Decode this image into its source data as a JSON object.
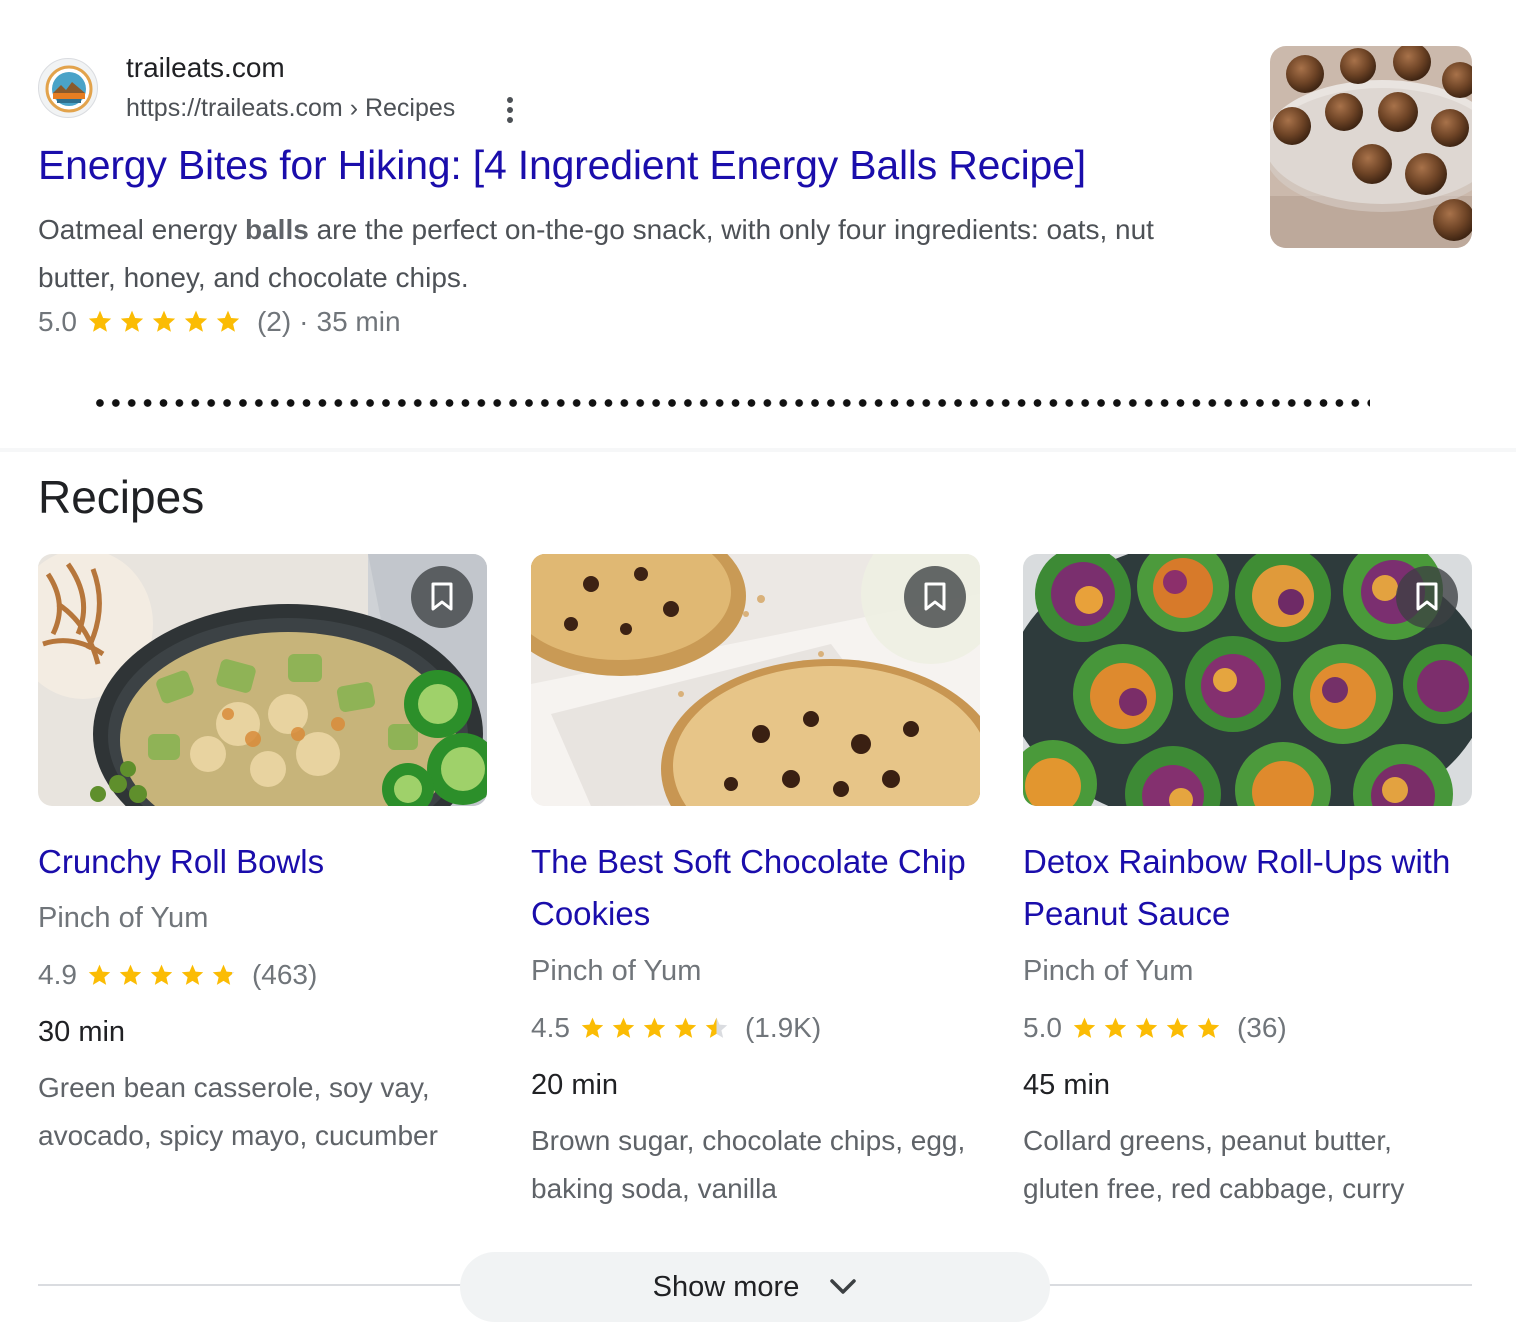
{
  "result": {
    "site_name": "traileats.com",
    "url": "https://traileats.com › Recipes",
    "title": "Energy Bites for Hiking: [4 Ingredient Energy Balls Recipe]",
    "snippet_before": "Oatmeal energy ",
    "snippet_bold": "balls",
    "snippet_after": " are the perfect on-the-go snack, with only four ingredients: oats, nut butter, honey, and chocolate chips.",
    "rating": "5.0",
    "rating_value": 5.0,
    "reviews": "(2)",
    "separator": "·",
    "time": "35 min",
    "thumbnail": "energy-balls-photo",
    "favicon": "traileats-logo"
  },
  "recipes": {
    "heading": "Recipes",
    "items": [
      {
        "title": "Crunchy Roll Bowls",
        "source": "Pinch of Yum",
        "rating": "4.9",
        "rating_value": 4.9,
        "reviews": "(463)",
        "time": "30 min",
        "ingredients": "Green bean casserole, soy vay, avocado, spicy mayo, cucumber",
        "image": "crunchy-roll-bowl-photo"
      },
      {
        "title": "The Best Soft Chocolate Chip Cookies",
        "source": "Pinch of Yum",
        "rating": "4.5",
        "rating_value": 4.5,
        "reviews": "(1.9K)",
        "time": "20 min",
        "ingredients": "Brown sugar, chocolate chips, egg, baking soda, vanilla",
        "image": "chocolate-chip-cookies-photo"
      },
      {
        "title": "Detox Rainbow Roll-Ups with Peanut Sauce",
        "source": "Pinch of Yum",
        "rating": "5.0",
        "rating_value": 5.0,
        "reviews": "(36)",
        "time": "45 min",
        "ingredients": "Collard greens, peanut butter, gluten free, red cabbage, curry",
        "image": "rainbow-roll-ups-photo"
      }
    ]
  },
  "show_more": {
    "label": "Show more"
  },
  "colors": {
    "link": "#1a0dab",
    "star": "#fbbc04",
    "star_empty": "#dadce0",
    "muted_text": "#70757a",
    "button_bg": "#f1f3f4"
  }
}
